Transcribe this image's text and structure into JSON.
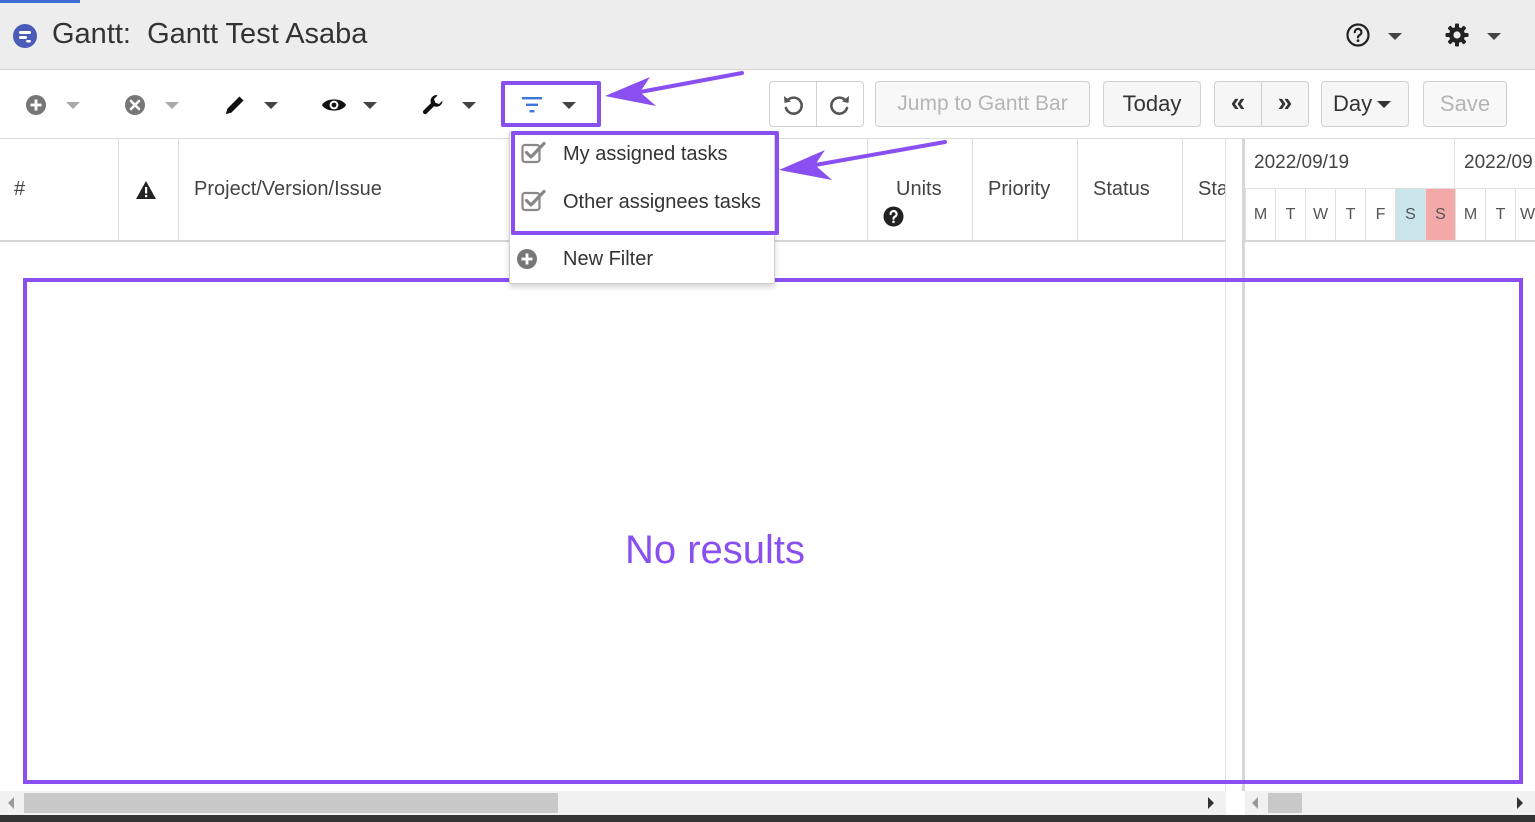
{
  "window": {
    "title": "Gantt:  Gantt Test Asaba"
  },
  "toolbar": {
    "jump_label": "Jump to Gantt Bar",
    "today_label": "Today",
    "prev_label": "«",
    "next_label": "»",
    "zoom_label": "Day",
    "save_label": "Save"
  },
  "filter_menu": {
    "items": [
      {
        "label": "My assigned tasks",
        "checked": true
      },
      {
        "label": "Other assignees tasks",
        "checked": true
      }
    ],
    "new_filter_label": "New Filter"
  },
  "grid": {
    "columns": [
      {
        "label": "#"
      },
      {
        "label": "Project/Version/Issue"
      },
      {
        "label": "Units"
      },
      {
        "label": "Priority"
      },
      {
        "label": "Status"
      },
      {
        "label": "Sta"
      }
    ],
    "empty_message": "No results"
  },
  "timeline": {
    "weeks": [
      "2022/09/19",
      "2022/09"
    ],
    "days": [
      "M",
      "T",
      "W",
      "T",
      "F",
      "S",
      "S",
      "M",
      "T",
      "W"
    ],
    "saturday_color": "#c9e4ea",
    "sunday_color": "#f4a9a9"
  },
  "colors": {
    "annotation": "#8a4ff0",
    "filter_icon": "#3d78d6"
  }
}
